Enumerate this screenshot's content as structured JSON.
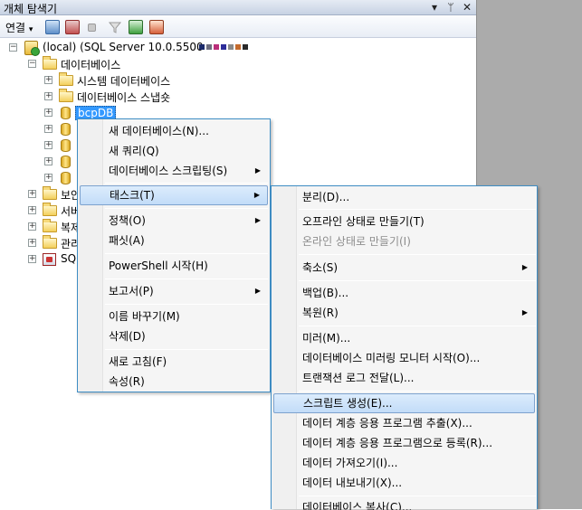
{
  "window": {
    "title": "개체 탐색기",
    "buttons": [
      "▾",
      "ᛘ",
      "✕"
    ]
  },
  "toolbar": {
    "connect_label": "연결",
    "connect_arrow": "▾"
  },
  "tree": {
    "server_label": "(local) (SQL Server 10.0.5500",
    "databases_folder": "데이터베이스",
    "system_databases": "시스템 데이터베이스",
    "db_snapshots": "데이터베이스 스냅숏",
    "selected_db": "bcpDB",
    "partial_security": "보안",
    "partial_server_objects": "서버",
    "partial_replication": "복제",
    "partial_management": "관리",
    "partial_sql_agent": "SQL"
  },
  "context_menu": {
    "items": [
      {
        "label": "새 데이터베이스(N)..."
      },
      {
        "label": "새 쿼리(Q)"
      },
      {
        "label": "데이터베이스 스크립팅(S)",
        "submenu": true
      },
      {
        "label": "태스크(T)",
        "submenu": true,
        "highlighted": true
      },
      {
        "label": "정책(O)",
        "submenu": true
      },
      {
        "label": "패싯(A)"
      },
      {
        "label": "PowerShell 시작(H)"
      },
      {
        "label": "보고서(P)",
        "submenu": true
      },
      {
        "label": "이름 바꾸기(M)"
      },
      {
        "label": "삭제(D)"
      },
      {
        "label": "새로 고침(F)"
      },
      {
        "label": "속성(R)"
      }
    ]
  },
  "tasks_menu": {
    "items": [
      {
        "label": "분리(D)..."
      },
      {
        "label": "오프라인 상태로 만들기(T)"
      },
      {
        "label": "온라인 상태로 만들기(I)",
        "disabled": true
      },
      {
        "label": "축소(S)",
        "submenu": true
      },
      {
        "label": "백업(B)..."
      },
      {
        "label": "복원(R)",
        "submenu": true
      },
      {
        "label": "미러(M)..."
      },
      {
        "label": "데이터베이스 미러링 모니터 시작(O)..."
      },
      {
        "label": "트랜잭션 로그 전달(L)..."
      },
      {
        "label": "스크립트 생성(E)...",
        "highlighted": true
      },
      {
        "label": "데이터 계층 응용 프로그램 추출(X)..."
      },
      {
        "label": "데이터 계층 응용 프로그램으로 등록(R)..."
      },
      {
        "label": "데이터 가져오기(I)..."
      },
      {
        "label": "데이터 내보내기(X)..."
      },
      {
        "label": "데이터베이스 복사(C)..."
      }
    ]
  },
  "arrow_glyph": "▶",
  "colors": {
    "selection": "#3399ff",
    "menu_border": "#3e8dc4",
    "highlight": "#c2dcf8"
  }
}
